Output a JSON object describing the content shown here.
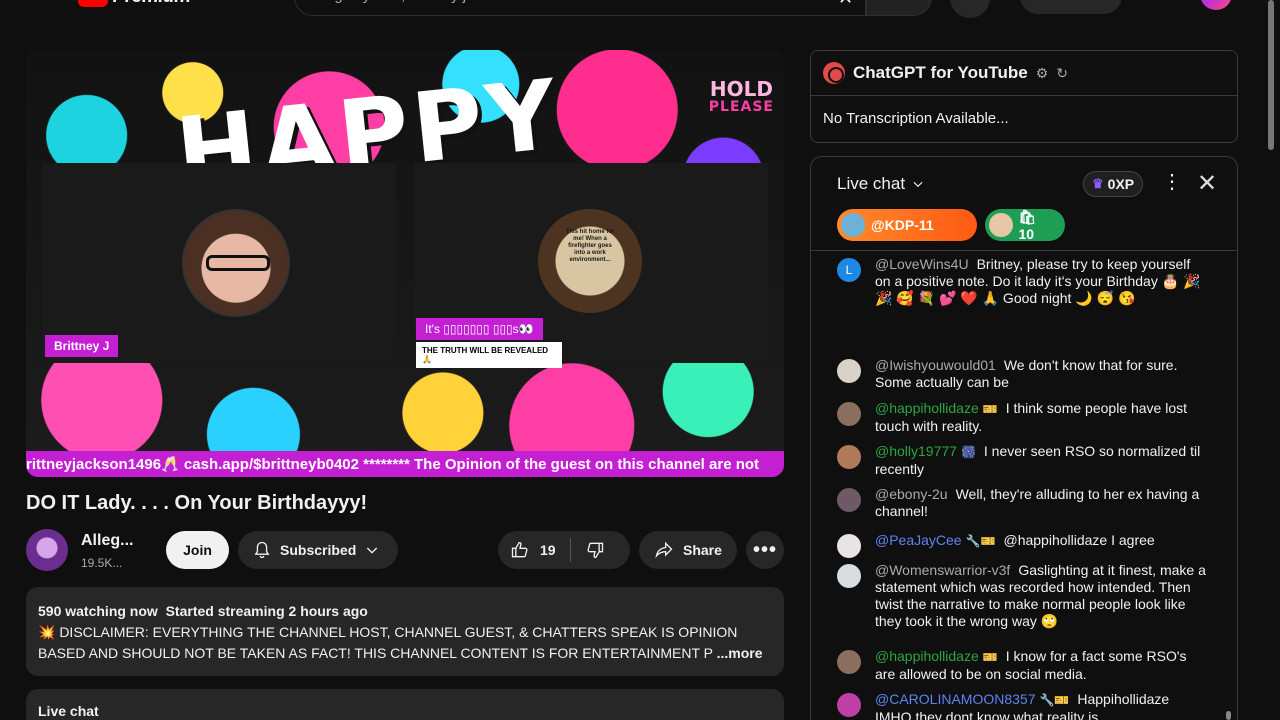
{
  "masthead": {
    "brand": "Premium",
    "search_value": "allegedly with, brittney j"
  },
  "player": {
    "art_title": "HAPPY",
    "hold_line1": "HOLD",
    "hold_line2": "PLEASE",
    "host_name_tag": "Brittney J",
    "book_text": "This hit home for me! When a firefighter goes into a work environment...",
    "guest_tag_line1": "It's ▯▯▯▯▯▯▯ ▯▯▯s👀",
    "guest_tag_line2": "THE TRUTH WILL BE REVEALED 🙏",
    "ticker_text": "rittneyjackson1496🥂 cash.app/$brittneyb0402 ******** The Opinion of the guest on this channel are not"
  },
  "video": {
    "title": "DO IT Lady. . . . On Your Birthdayyy!",
    "channel_name": "Alleg...",
    "subscribers": "19.5K...",
    "join_label": "Join",
    "subscribed_label": "Subscribed",
    "like_count": "19",
    "share_label": "Share"
  },
  "description": {
    "watching": "590 watching now",
    "started": "Started streaming 2 hours ago",
    "line1": "💥 DISCLAIMER: EVERYTHING THE CHANNEL HOST, CHANNEL GUEST, & CHATTERS SPEAK IS OPINION",
    "line2": "BASED AND SHOULD NOT BE TAKEN AS FACT!  THIS CHANNEL CONTENT IS FOR ENTERTAINMENT P",
    "more": "...more"
  },
  "livechat_collapsed": {
    "label": "Live chat"
  },
  "chatgpt": {
    "title": "ChatGPT for YouTube",
    "body": "No Transcription Available..."
  },
  "chat": {
    "title": "Live chat",
    "xp": "0XP",
    "chips": [
      {
        "label": "@KDP-11"
      },
      {
        "label": "🛍 10"
      }
    ],
    "messages": [
      {
        "author": "@LoveWins4U",
        "text": "Britney, please try to keep yourself on a positive note. Do it lady it's your Birthday 🎂 🎉 🎉 🥰 💐 💕 ❤️ 🙏 Good night 🌙 😴 😘",
        "avatar_letter": "L",
        "avatar_color": "#1e88e5"
      },
      {
        "author": "@Iwishyouwould01",
        "text": "We don't know that for sure. Some actually can be",
        "avatar_color": "#d8d2c8"
      },
      {
        "author": "@happihollidaze",
        "badge": "🎫",
        "text": "I think some people have lost touch with reality.",
        "avatar_color": "#8a6e5e"
      },
      {
        "author": "@holly19777",
        "badge": "🎆",
        "text": "I never seen RSO so normalized til recently",
        "avatar_color": "#b07a5a"
      },
      {
        "author": "@ebony-2u",
        "text": "Well, they're alluding to her ex having a channel!",
        "avatar_color": "#6e5a66"
      },
      {
        "author": "@PeaJayCee",
        "badge": "🔧🎫",
        "text": "@happihollidaze I agree",
        "avatar_color": "#e9e3e3"
      },
      {
        "author": "@Womenswarrior-v3f",
        "text": "Gaslighting at it finest, make a statement which was recorded how intended. Then twist the narrative to make normal people look like they took it the wrong way 🙄",
        "avatar_color": "#d8dde2"
      },
      {
        "author": "@happihollidaze",
        "badge": "🎫",
        "text": "I know for a fact some RSO's are allowed to be on social media.",
        "avatar_color": "#8a6e5e"
      },
      {
        "author": "@CAROLINAMOON8357",
        "badge": "🔧🎫",
        "text": "Happihollidaze IMHO they dont know what reality is",
        "avatar_color": "#c03fa6"
      }
    ]
  }
}
